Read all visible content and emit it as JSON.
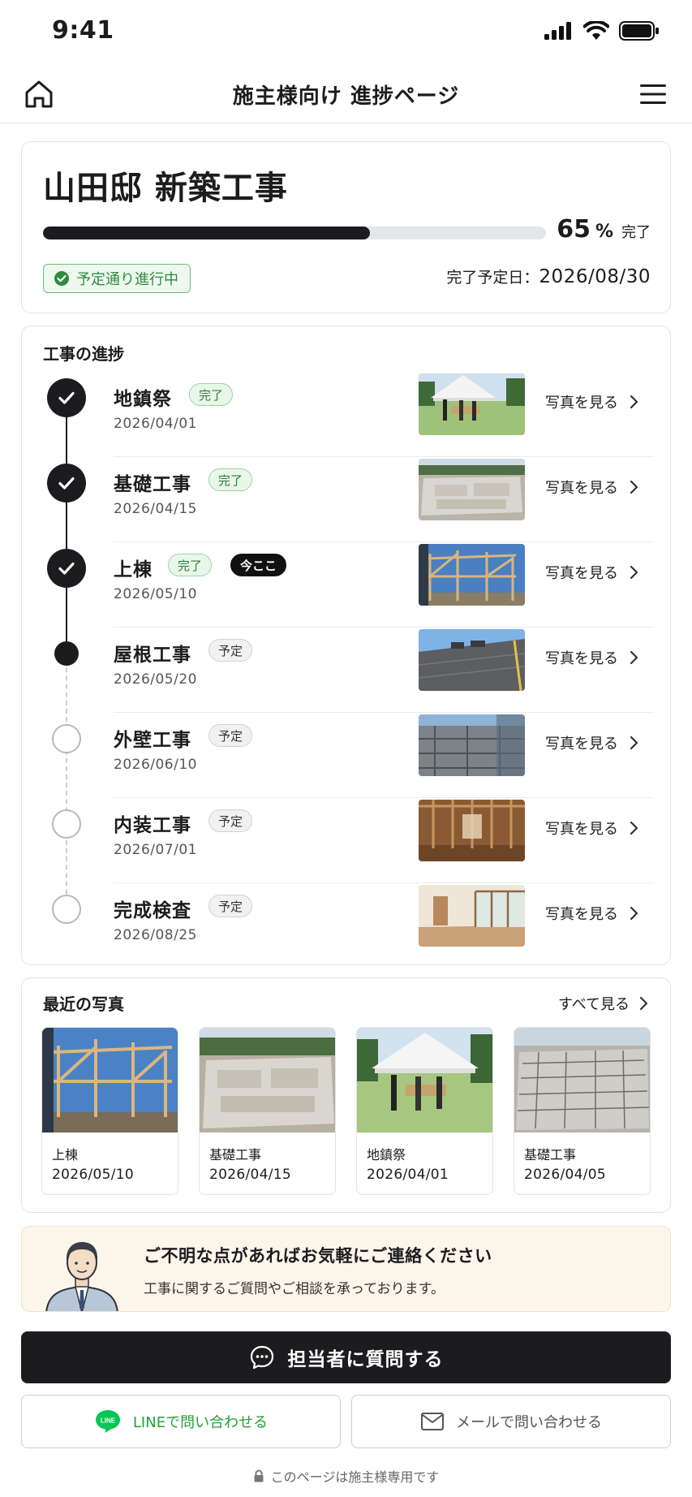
{
  "status_bar": {
    "time": "9:41"
  },
  "header": {
    "title": "施主様向け 進捗ページ"
  },
  "summary": {
    "project_name": "山田邸 新築工事",
    "progress_percent": 65,
    "progress_num": "65",
    "progress_unit": "%",
    "progress_done_label": "完了",
    "status_label": "予定通り進行中",
    "due_label": "完了予定日：",
    "due_date": "2026/08/30"
  },
  "progress": {
    "title": "工事の進捗",
    "view_label": "写真を見る",
    "steps": [
      {
        "name": "地鎮祭",
        "date": "2026/04/01",
        "state": "done",
        "badge": "完了"
      },
      {
        "name": "基礎工事",
        "date": "2026/04/15",
        "state": "done",
        "badge": "完了"
      },
      {
        "name": "上棟",
        "date": "2026/05/10",
        "state": "done",
        "badge": "完了",
        "here": "今ここ"
      },
      {
        "name": "屋根工事",
        "date": "2026/05/20",
        "state": "current",
        "badge": "予定"
      },
      {
        "name": "外壁工事",
        "date": "2026/06/10",
        "state": "todo",
        "badge": "予定"
      },
      {
        "name": "内装工事",
        "date": "2026/07/01",
        "state": "todo",
        "badge": "予定"
      },
      {
        "name": "完成検査",
        "date": "2026/08/25",
        "state": "todo",
        "badge": "予定"
      }
    ]
  },
  "recent": {
    "title": "最近の写真",
    "see_all": "すべて見る",
    "photos": [
      {
        "name": "上棟",
        "date": "2026/05/10"
      },
      {
        "name": "基礎工事",
        "date": "2026/04/15"
      },
      {
        "name": "地鎮祭",
        "date": "2026/04/01"
      },
      {
        "name": "基礎工事",
        "date": "2026/04/05"
      }
    ]
  },
  "contact": {
    "title": "ご不明な点があればお気軽にご連絡ください",
    "subtitle": "工事に関するご質問やご相談を承っております。"
  },
  "buttons": {
    "ask": "担当者に質問する",
    "line": "LINEで問い合わせる",
    "line_icon_text": "LINE",
    "mail": "メールで問い合わせる"
  },
  "footer": {
    "note": "このページは施主様専用です"
  },
  "colors": {
    "accent": "#1c1c1e",
    "success": "#2e8b3e",
    "line_green": "#06c755",
    "contact_bg": "#fbf5ea"
  }
}
